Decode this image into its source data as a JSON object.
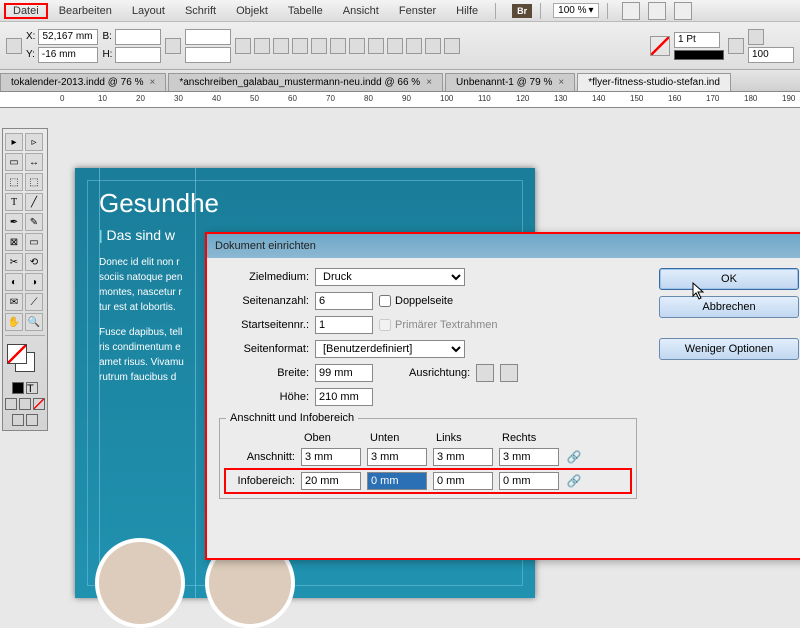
{
  "menu": [
    "Datei",
    "Bearbeiten",
    "Layout",
    "Schrift",
    "Objekt",
    "Tabelle",
    "Ansicht",
    "Fenster",
    "Hilfe"
  ],
  "zoom": "100 %",
  "br": "Br",
  "coords": {
    "x_label": "X:",
    "x": "52,167 mm",
    "y_label": "Y:",
    "y": "-16 mm",
    "b_label": "B:",
    "h_label": "H:"
  },
  "stroke_weight": "1 Pt",
  "stroke_100": "100",
  "tabs": [
    {
      "label": "tokalender-2013.indd @ 76 %"
    },
    {
      "label": "*anschreiben_galabau_mustermann-neu.indd @ 66 %"
    },
    {
      "label": "Unbenannt-1 @ 79 %"
    },
    {
      "label": "*flyer-fitness-studio-stefan.ind"
    }
  ],
  "ruler_marks": [
    "0",
    "10",
    "20",
    "30",
    "40",
    "50",
    "60",
    "70",
    "80",
    "90",
    "100",
    "110",
    "120",
    "130",
    "140",
    "150",
    "160",
    "170",
    "180",
    "190"
  ],
  "doc": {
    "headline": "Gesundhe",
    "subhead": "Das sind w",
    "p1": "Donec id elit non r\nsociis natoque pen\nmontes, nascetur r\ntur est at lobortis.",
    "p2": "Fusce dapibus, tell\nris condimentum e\namet risus. Vivamu\nrutrum faucibus d"
  },
  "dialog": {
    "title": "Dokument einrichten",
    "zielmedium_label": "Zielmedium:",
    "zielmedium": "Druck",
    "seitenanzahl_label": "Seitenanzahl:",
    "seitenanzahl": "6",
    "doppelseite": "Doppelseite",
    "startseite_label": "Startseitennr.:",
    "startseite": "1",
    "textr": "Primärer Textrahmen",
    "seitenformat_label": "Seitenformat:",
    "seitenformat": "[Benutzerdefiniert]",
    "breite_label": "Breite:",
    "breite": "99 mm",
    "hoehe_label": "Höhe:",
    "hoehe": "210 mm",
    "ausrichtung_label": "Ausrichtung:",
    "fieldset": "Anschnitt und Infobereich",
    "cols": [
      "Oben",
      "Unten",
      "Links",
      "Rechts"
    ],
    "anschnitt_label": "Anschnitt:",
    "anschnitt": [
      "3 mm",
      "3 mm",
      "3 mm",
      "3 mm"
    ],
    "info_label": "Infobereich:",
    "info": [
      "20 mm",
      "0 mm",
      "0 mm",
      "0 mm"
    ],
    "ok": "OK",
    "cancel": "Abbrechen",
    "less": "Weniger Optionen"
  }
}
